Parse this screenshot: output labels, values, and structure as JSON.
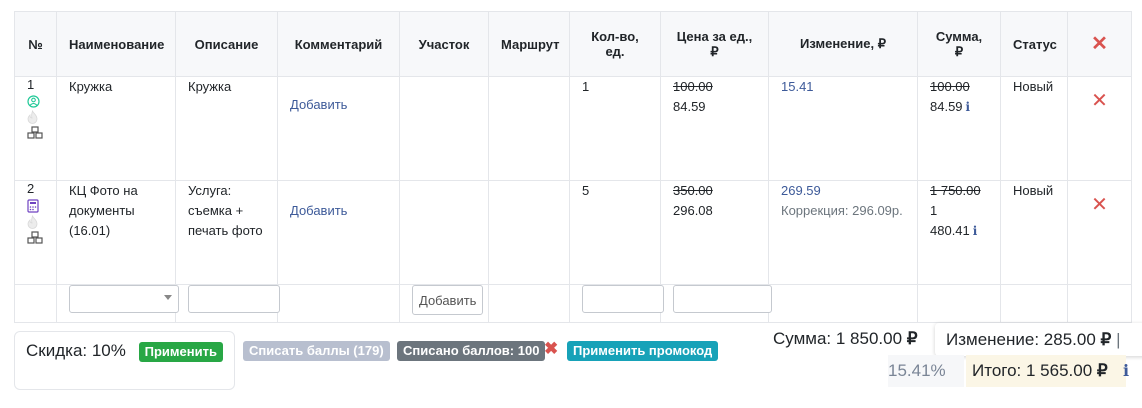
{
  "table": {
    "headers": [
      "№",
      "Наименование",
      "Описание",
      "Комментарий",
      "Участок",
      "Маршрут",
      "Кол-во, ед.",
      "Цена за ед., ₽",
      "Изменение, ₽",
      "Сумма, ₽",
      "Статус"
    ],
    "rows": [
      {
        "num": "1",
        "icons": [
          "user-circle-icon",
          "flame-icon",
          "boxes-icon"
        ],
        "name": "Кружка",
        "description": "Кружка",
        "comment_link": "Добавить",
        "qty": "1",
        "price_old": "100.00",
        "price_new": "84.59",
        "change": "15.41",
        "change_note": "",
        "sum_old": "100.00",
        "sum_new": "84.59",
        "status": "Новый"
      },
      {
        "num": "2",
        "icons": [
          "calculator-icon",
          "flame-icon",
          "boxes-icon"
        ],
        "name": "КЦ Фото на документы (16.01)",
        "description": "Услуга: съемка + печать фото",
        "comment_link": "Добавить",
        "qty": "5",
        "price_old": "350.00",
        "price_new": "296.08",
        "change": "269.59",
        "change_note": "Коррекция: 296.09р.",
        "sum_old": "1 750.00",
        "sum_new": "1 480.41",
        "status": "Новый"
      }
    ],
    "new_row": {
      "add_button": "Добавить"
    }
  },
  "footer": {
    "discount_label": "Скидка: 10%",
    "apply_button": "Применить",
    "write_off_button": "Списать баллы (179)",
    "written_off_badge": "Списано баллов: 100",
    "promo_button": "Применить промокод",
    "sum_label": "Сумма: 1 850.00",
    "change_label": "Изменение: 285.00",
    "change_percent": "15.41%",
    "total_label": "Итого: 1 565.00",
    "currency": "₽",
    "separator": "|"
  },
  "colors": {
    "delete": "#d9534f",
    "link": "#3d5a99",
    "apply": "#28a745",
    "promo": "#17a2b8",
    "written_off": "#6c757d",
    "write_off_disabled": "#b8bfcf",
    "total_bg": "#fbf6e6"
  }
}
